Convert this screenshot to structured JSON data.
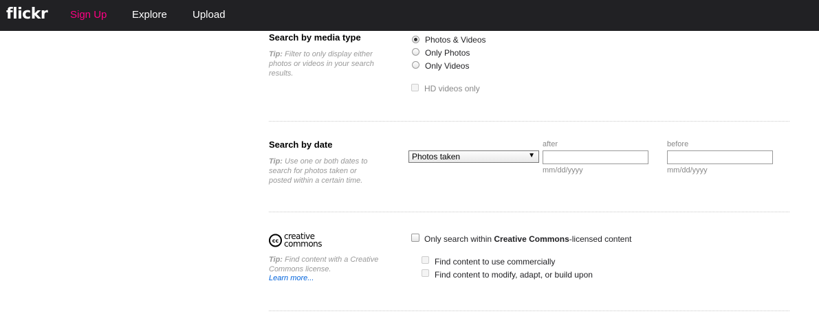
{
  "header": {
    "logo": "flickr",
    "nav": [
      "Sign Up",
      "Explore",
      "Upload"
    ]
  },
  "media": {
    "heading": "Search by media type",
    "tip_prefix": "Tip:",
    "tip_text": " Filter to only display either photos or videos in your search results.",
    "options": [
      "Photos & Videos",
      "Only Photos",
      "Only Videos"
    ],
    "selected": "Photos & Videos",
    "hd_label": "HD videos only"
  },
  "date": {
    "heading": "Search by date",
    "tip_prefix": "Tip:",
    "tip_text": " Use one or both dates to search for photos taken or posted within a certain time.",
    "select_value": "Photos taken",
    "after_label": "after",
    "before_label": "before",
    "after_placeholder": "mm/dd/yyyy",
    "before_placeholder": "mm/dd/yyyy"
  },
  "cc": {
    "logo_top": "creative",
    "logo_bottom": "commons",
    "logo_badge": "cc",
    "main_prefix": "Only search within ",
    "main_bold": "Creative Commons",
    "main_suffix": "-licensed content",
    "commercial_label": "Find content to use commercially",
    "modify_label": "Find content to modify, adapt, or build upon",
    "tip_prefix": "Tip:",
    "tip_text": " Find content with a Creative Commons license.",
    "learn_more": "Learn more..."
  },
  "colors": {
    "topbar": "#212124",
    "signup": "#ff0084",
    "link": "#0063dc"
  }
}
